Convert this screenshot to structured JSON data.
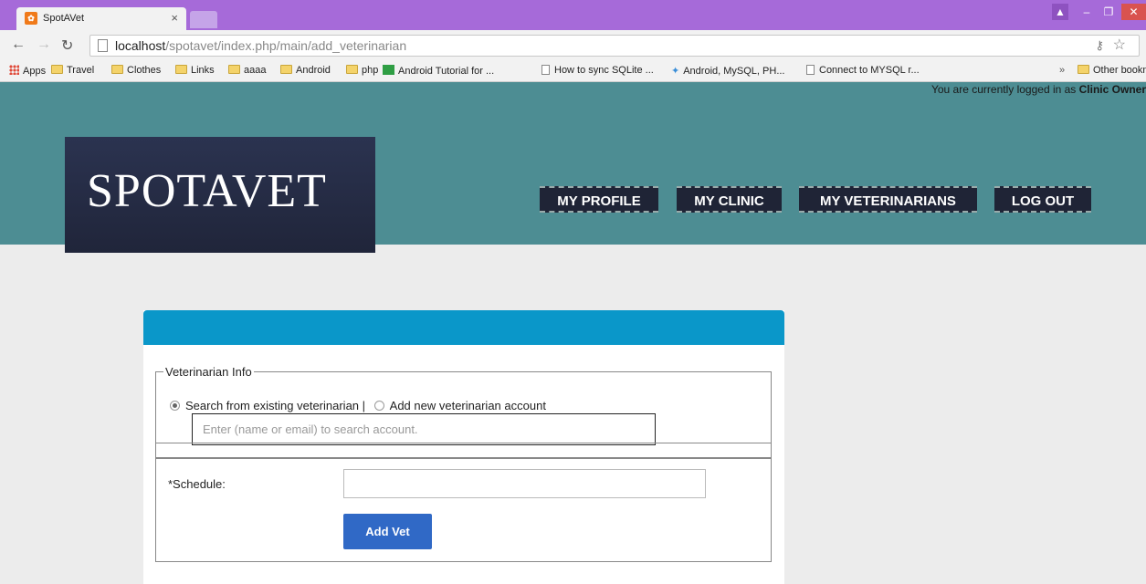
{
  "browser": {
    "tab_title": "SpotAVet",
    "tab_close": "×",
    "url_host": "localhost",
    "url_path": "/spotavet/index.php/main/add_veterinarian",
    "window_controls": [
      "–",
      "❐",
      "✕"
    ]
  },
  "bookmarks": {
    "apps": "Apps",
    "items": [
      "Travel",
      "Clothes",
      "Links",
      "aaaa",
      "Android",
      "php"
    ],
    "links": [
      "Android Tutorial for ...",
      "How to sync SQLite ...",
      "Android, MySQL, PH...",
      "Connect to MYSQL r..."
    ],
    "overflow": "»",
    "other": "Other bookmarks"
  },
  "header": {
    "login_prefix": "You are currently logged in as",
    "login_role": "Clinic Owner",
    "logo": "SPOTAVET",
    "nav": [
      "MY PROFILE",
      "MY CLINIC",
      "MY VETERINARIANS",
      "LOG OUT"
    ]
  },
  "form": {
    "legend": "Veterinarian Info",
    "option_search": "Search from existing veterinarian |",
    "option_add": "Add new veterinarian account",
    "search_placeholder": "Enter (name or email) to search account.",
    "schedule_label": "*Schedule:",
    "schedule_value": "",
    "submit_label": "Add Vet"
  },
  "colors": {
    "titlebar": "#a66ad9",
    "header": "#4d8d93",
    "logo_bg": "#232940",
    "card_header": "#0a97c9",
    "button": "#3069c6"
  }
}
